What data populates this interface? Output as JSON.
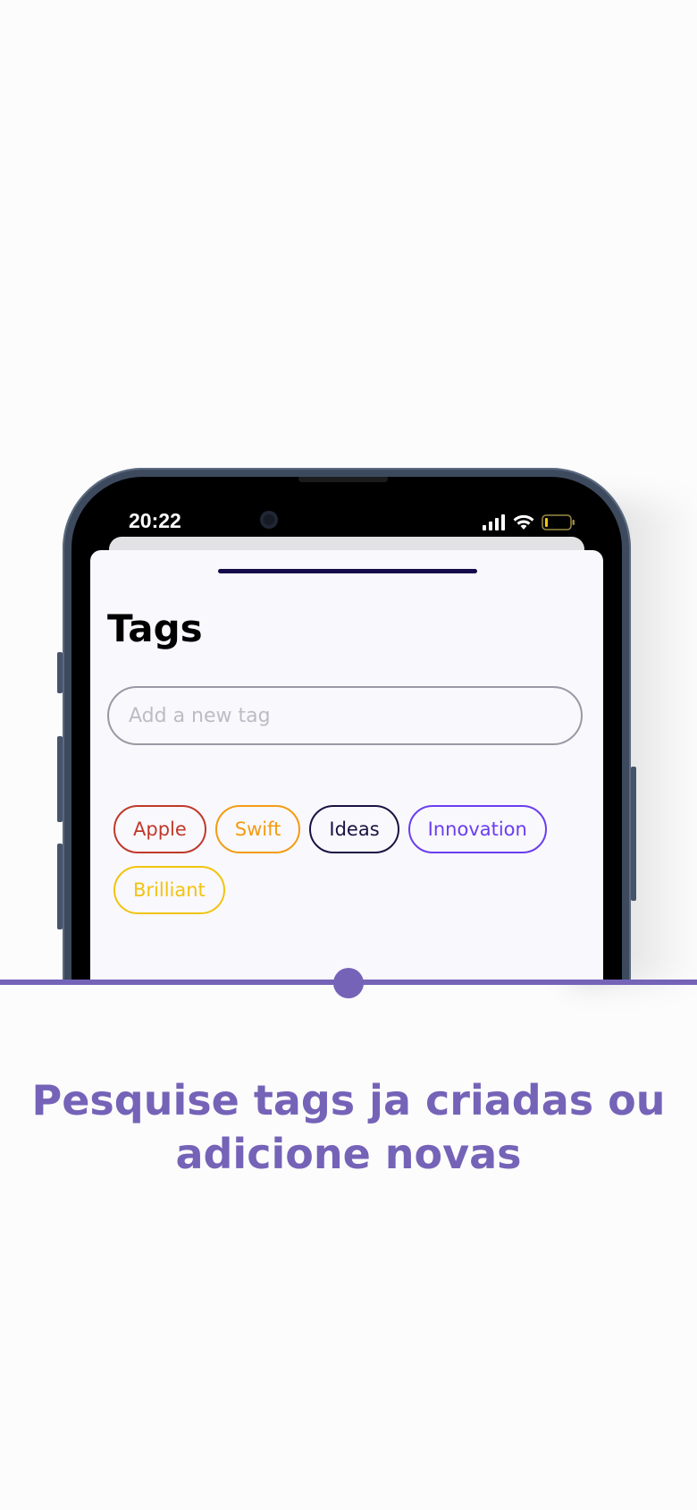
{
  "status_bar": {
    "time": "20:22"
  },
  "screen": {
    "title": "Tags",
    "input_placeholder": "Add a new tag",
    "tags": [
      {
        "label": "Apple",
        "color": "#c0392b"
      },
      {
        "label": "Swift",
        "color": "#f39c12"
      },
      {
        "label": "Ideas",
        "color": "#1b1242"
      },
      {
        "label": "Innovation",
        "color": "#6a3df0"
      },
      {
        "label": "Brilliant",
        "color": "#f1c40f"
      }
    ]
  },
  "caption": {
    "text": "Pesquise tags ja criadas ou adicione novas"
  },
  "theme": {
    "accent": "#7563b8",
    "background": "#fcfcfc"
  }
}
